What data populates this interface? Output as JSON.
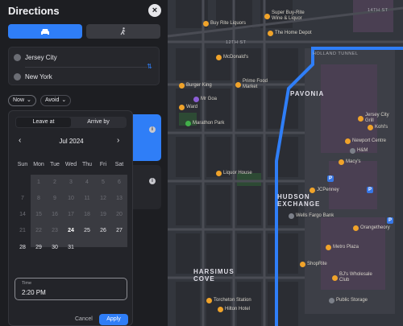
{
  "panel": {
    "title": "Directions",
    "close_icon": "x-icon",
    "modes": [
      "car-icon",
      "walking-icon"
    ],
    "origin": "Jersey City",
    "destination": "New York",
    "swap_icon": "swap-vertical-icon",
    "now_label": "Now",
    "avoid_label": "Avoid"
  },
  "picker": {
    "tab_leave": "Leave at",
    "tab_arrive": "Arrive by",
    "month": "Jul 2024",
    "weekdays": [
      "Sun",
      "Mon",
      "Tue",
      "Wed",
      "Thu",
      "Fri",
      "Sat"
    ],
    "rows": [
      [
        "",
        "1",
        "2",
        "3",
        "4",
        "5",
        "6"
      ],
      [
        "7",
        "8",
        "9",
        "10",
        "11",
        "12",
        "13"
      ],
      [
        "14",
        "15",
        "16",
        "17",
        "18",
        "19",
        "20"
      ],
      [
        "21",
        "22",
        "23",
        "24",
        "25",
        "26",
        "27"
      ],
      [
        "28",
        "29",
        "30",
        "31",
        "",
        "",
        ""
      ]
    ],
    "selected_day": "24",
    "time_label": "Time",
    "time_value": "2:20 PM",
    "cancel": "Cancel",
    "apply": "Apply"
  },
  "map": {
    "streets": [
      "14TH ST",
      "12TH ST",
      "HOLLAND TUNNEL"
    ],
    "districts": [
      "PAVONIA",
      "HUDSON\nEXCHANGE",
      "HARSIMUS\nCOVE"
    ],
    "pois": [
      {
        "name": "Super Buy-Rite\nWine & Liquor"
      },
      {
        "name": "Buy Rite Liquors"
      },
      {
        "name": "The Home Depot"
      },
      {
        "name": "McDonald's"
      },
      {
        "name": "Prime Food\nMarket"
      },
      {
        "name": "Burger King"
      },
      {
        "name": "Mr Goa"
      },
      {
        "name": "Ward"
      },
      {
        "name": "Marathon Park"
      },
      {
        "name": "Liquor House"
      },
      {
        "name": "Jersey City\nGrill"
      },
      {
        "name": "Kohl's"
      },
      {
        "name": "Newport Centre"
      },
      {
        "name": "H&M"
      },
      {
        "name": "Macy's"
      },
      {
        "name": "JCPenney"
      },
      {
        "name": "Wells Fargo Bank"
      },
      {
        "name": "Orangetheory"
      },
      {
        "name": "Metro Plaza"
      },
      {
        "name": "ShopRite"
      },
      {
        "name": "BJ's Wholesale\nClub"
      },
      {
        "name": "Public Storage"
      },
      {
        "name": "Torcheton Station"
      },
      {
        "name": "Hilton Hotel"
      }
    ]
  }
}
